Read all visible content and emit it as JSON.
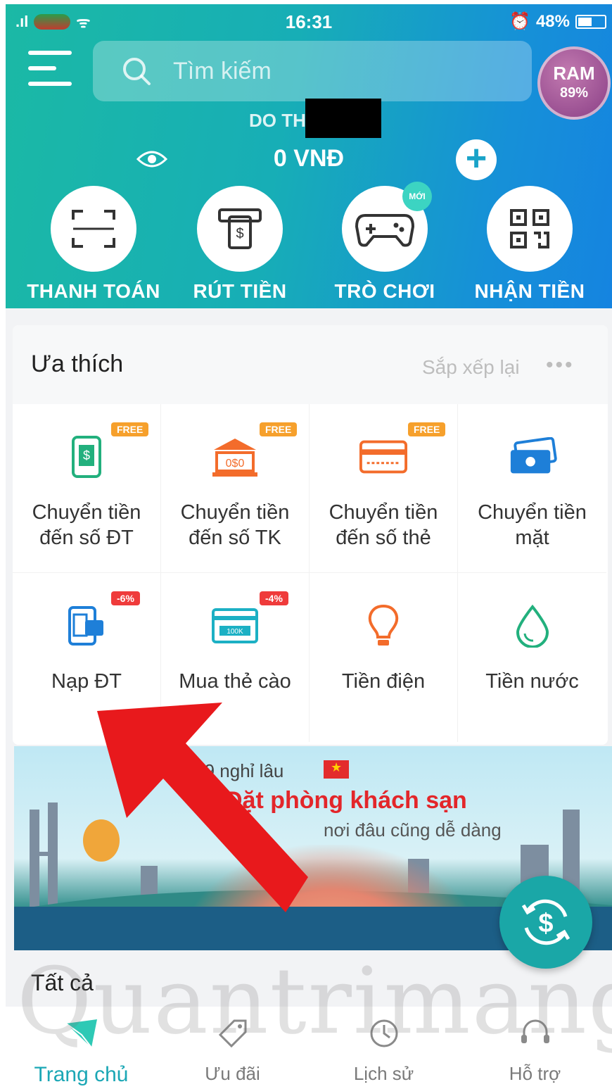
{
  "status_bar": {
    "time": "16:31",
    "battery": "48%"
  },
  "header": {
    "search_placeholder": "Tìm kiếm",
    "ram": {
      "label": "RAM",
      "value": "89%"
    },
    "user_name": "DO TH",
    "balance": "0 VNĐ"
  },
  "actions": [
    {
      "label": "THANH TOÁN",
      "icon": "scan-icon"
    },
    {
      "label": "RÚT TIỀN",
      "icon": "atm-withdraw-icon"
    },
    {
      "label": "TRÒ CHƠI",
      "icon": "gamepad-icon",
      "badge": "MỚI"
    },
    {
      "label": "NHẬN TIỀN",
      "icon": "qr-code-icon"
    }
  ],
  "favorites": {
    "title": "Ưa thích",
    "sort_label": "Sắp xếp lại",
    "more": "•••",
    "items": [
      {
        "line1": "Chuyển tiền",
        "line2": "đến số ĐT",
        "tag": "FREE",
        "icon": "phone-transfer-icon"
      },
      {
        "line1": "Chuyển tiền",
        "line2": "đến số TK",
        "tag": "FREE",
        "icon": "bank-icon"
      },
      {
        "line1": "Chuyển tiền",
        "line2": "đến số thẻ",
        "tag": "FREE",
        "icon": "card-icon"
      },
      {
        "line1": "Chuyển tiền",
        "line2": "mặt",
        "tag": "",
        "icon": "cash-icon"
      },
      {
        "line1": "Nạp ĐT",
        "line2": "",
        "tag": "-6%",
        "icon": "phone-topup-icon"
      },
      {
        "line1": "Mua thẻ cào",
        "line2": "",
        "tag": "-4%",
        "icon": "scratch-card-icon"
      },
      {
        "line1": "Tiền điện",
        "line2": "",
        "tag": "",
        "icon": "bulb-icon"
      },
      {
        "line1": "Tiền nước",
        "line2": "",
        "tag": "",
        "icon": "water-drop-icon"
      }
    ]
  },
  "banner": {
    "subtitle": "ng 29 nghỉ lâu",
    "title": "Đặt phòng khách sạn",
    "tagline": "nơi đâu cũng dễ dàng"
  },
  "section_all": "Tất cả",
  "watermark": "Quantrimang",
  "bottom_nav": [
    {
      "label": "Trang chủ",
      "icon": "home-icon"
    },
    {
      "label": "Ưu đãi",
      "icon": "promo-tag-icon"
    },
    {
      "label": "Lịch sử",
      "icon": "history-clock-icon"
    },
    {
      "label": "Hỗ trợ",
      "icon": "support-icon"
    }
  ],
  "colors": {
    "accent": "#1ba7b5",
    "arrow": "#e8191c",
    "free_tag": "#f6a02c",
    "discount_tag": "#ef3b3b"
  }
}
